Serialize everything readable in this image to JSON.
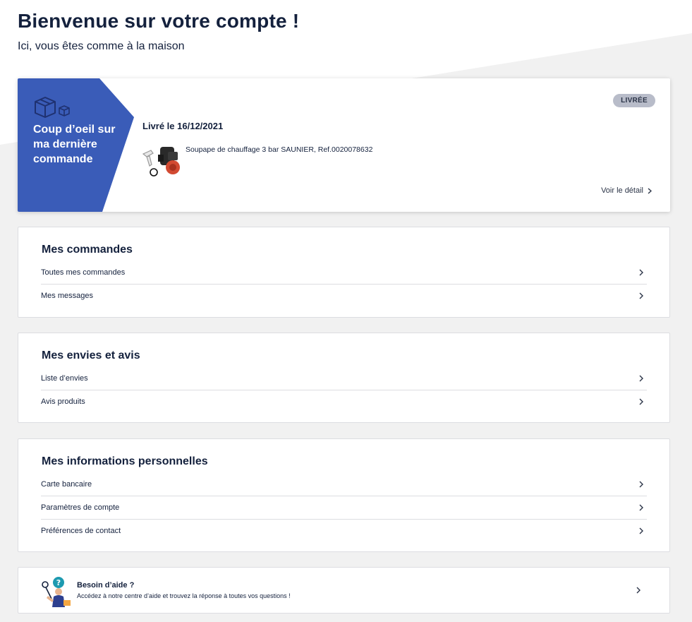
{
  "header": {
    "title": "Bienvenue sur votre compte !",
    "subtitle": "Ici, vous êtes comme à la maison"
  },
  "last_order": {
    "banner_label": "Coup d’oeil sur ma dernière commande",
    "status": "LIVRÉE",
    "delivered_label": "Livré le 16/12/2021",
    "product_name": "Soupape de chauffage 3 bar SAUNIER, Ref.0020078632",
    "detail_link": "Voir le détail",
    "banner_color": "#3a5cb8",
    "icons": [
      "box-icon",
      "small-box-icon",
      "chevron-right-icon"
    ]
  },
  "orders_section": {
    "title": "Mes commandes",
    "items": [
      {
        "label": "Toutes mes commandes"
      },
      {
        "label": "Mes messages"
      }
    ]
  },
  "wishlist_section": {
    "title": "Mes envies et avis",
    "items": [
      {
        "label": "Liste d’envies"
      },
      {
        "label": "Avis produits"
      }
    ]
  },
  "personal_section": {
    "title": "Mes informations personnelles",
    "items": [
      {
        "label": "Carte bancaire"
      },
      {
        "label": "Paramètres de compte"
      },
      {
        "label": "Préférences de contact"
      }
    ]
  },
  "help": {
    "title": "Besoin d’aide ?",
    "description": "Accédez à notre centre d’aide et trouvez la réponse à toutes vos questions !"
  },
  "colors": {
    "text": "#14213d",
    "accent": "#3a5cb8",
    "badge_bg": "#b8bcc9",
    "divider": "#dcdde1"
  }
}
